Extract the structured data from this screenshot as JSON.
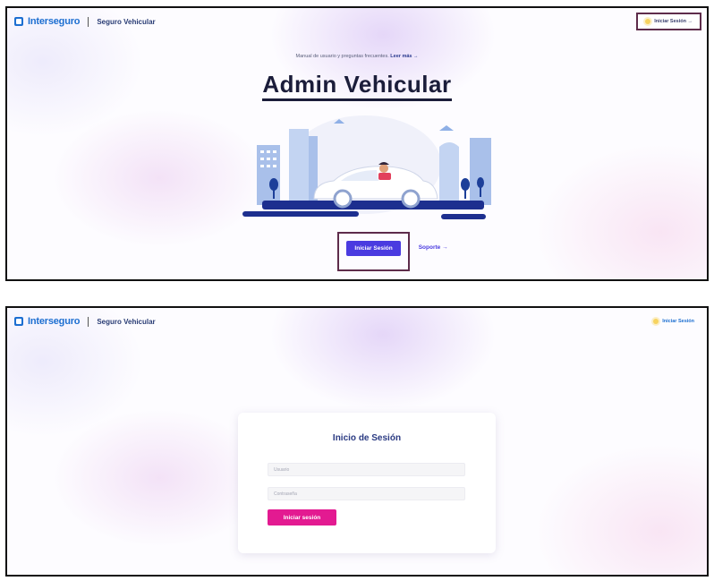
{
  "header": {
    "brand": "Interseguro",
    "product": "Seguro Vehicular",
    "login_label_1": "Iniciar Sesión →",
    "login_label_2": "Iniciar Sesión"
  },
  "hero": {
    "manual_text": "Manual de usuario y preguntas frecuentes.",
    "manual_link": "Leer más →",
    "title": "Admin Vehicular",
    "cta_label": "Iniciar Sesión",
    "support_label": "Soporte →"
  },
  "login": {
    "title": "Inicio de Sesión",
    "user_placeholder": "Usuario",
    "password_placeholder": "Contraseña",
    "submit_label": "Iniciar sesión"
  },
  "colors": {
    "brand_blue": "#1d6fd1",
    "primary_button": "#4a3be0",
    "login_button": "#e31a91",
    "highlight_border": "#5e2c4b"
  }
}
